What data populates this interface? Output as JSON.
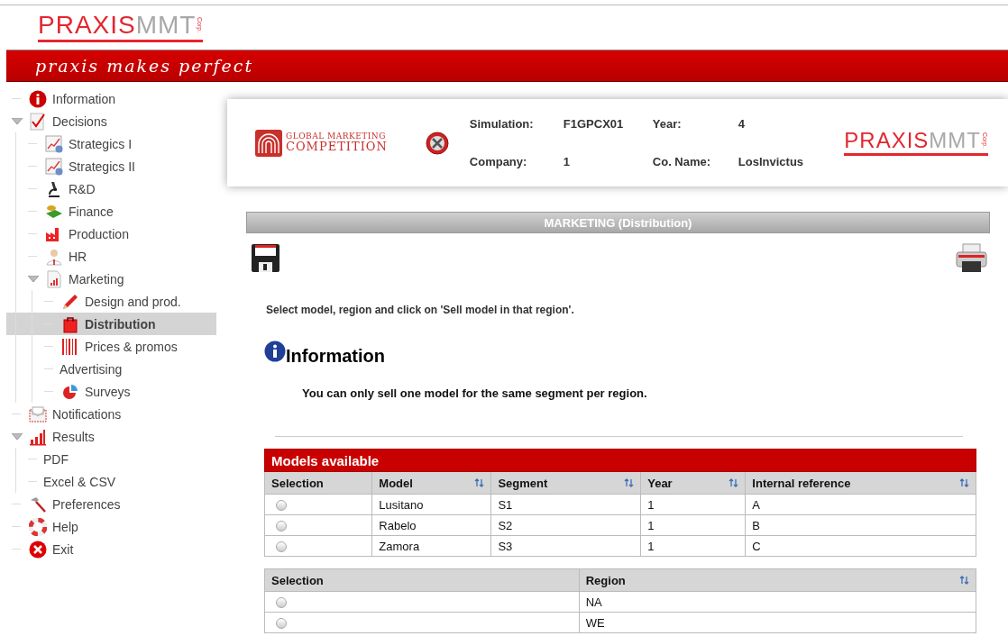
{
  "brand": {
    "logo": {
      "first": "PRAXIS",
      "second": "MMT",
      "suffix": "Corp."
    },
    "tagline": "praxis makes perfect"
  },
  "sidebar": {
    "items": [
      {
        "label": "Information",
        "selected": false
      },
      {
        "label": "Decisions",
        "selected": false,
        "expanded": true,
        "children": [
          {
            "label": "Strategics I",
            "selected": false
          },
          {
            "label": "Strategics II",
            "selected": false
          },
          {
            "label": "R&D",
            "selected": false
          },
          {
            "label": "Finance",
            "selected": false
          },
          {
            "label": "Production",
            "selected": false
          },
          {
            "label": "HR",
            "selected": false
          },
          {
            "label": "Marketing",
            "selected": false,
            "expanded": true,
            "children": [
              {
                "label": "Design and prod.",
                "selected": false
              },
              {
                "label": "Distribution",
                "selected": true
              },
              {
                "label": "Prices & promos",
                "selected": false
              },
              {
                "label": "Advertising",
                "selected": false
              },
              {
                "label": "Surveys",
                "selected": false
              }
            ]
          }
        ]
      },
      {
        "label": "Notifications",
        "selected": false
      },
      {
        "label": "Results",
        "selected": false,
        "expanded": true,
        "children": [
          {
            "label": "PDF",
            "selected": false
          },
          {
            "label": "Excel & CSV",
            "selected": false
          }
        ]
      },
      {
        "label": "Preferences",
        "selected": false
      },
      {
        "label": "Help",
        "selected": false
      },
      {
        "label": "Exit",
        "selected": false
      }
    ]
  },
  "header_card": {
    "competition_logo": {
      "line1": "GLOBAL MARKETING",
      "line2": "COMPETITION"
    },
    "fields": [
      {
        "label": "Simulation:",
        "value": "F1GPCX01"
      },
      {
        "label": "Year:",
        "value": "4"
      },
      {
        "label": "Company:",
        "value": "1"
      },
      {
        "label": "Co. Name:",
        "value": "LosInvictus"
      }
    ],
    "logo": {
      "first": "PRAXIS",
      "second": "MMT",
      "suffix": "Corp."
    }
  },
  "page_title": "MARKETING (Distribution)",
  "instruction": "Select model, region and click on 'Sell model in that region'.",
  "info": {
    "title": "Information",
    "message": "You can only sell one model for the same segment per region."
  },
  "models_table": {
    "title": "Models available",
    "columns": [
      {
        "label": "Selection",
        "sortable": false
      },
      {
        "label": "Model",
        "sortable": true
      },
      {
        "label": "Segment",
        "sortable": true
      },
      {
        "label": "Year",
        "sortable": true
      },
      {
        "label": "Internal reference",
        "sortable": true
      }
    ],
    "rows": [
      {
        "selected": false,
        "cells": [
          "",
          "Lusitano",
          "S1",
          "1",
          "A"
        ]
      },
      {
        "selected": false,
        "cells": [
          "",
          "Rabelo",
          "S2",
          "1",
          "B"
        ]
      },
      {
        "selected": false,
        "cells": [
          "",
          "Zamora",
          "S3",
          "1",
          "C"
        ]
      }
    ]
  },
  "regions_table": {
    "columns": [
      {
        "label": "Selection",
        "sortable": false
      },
      {
        "label": "Region",
        "sortable": true
      }
    ],
    "rows": [
      {
        "selected": false,
        "cells": [
          "",
          "NA"
        ]
      },
      {
        "selected": false,
        "cells": [
          "",
          "WE"
        ]
      }
    ]
  }
}
